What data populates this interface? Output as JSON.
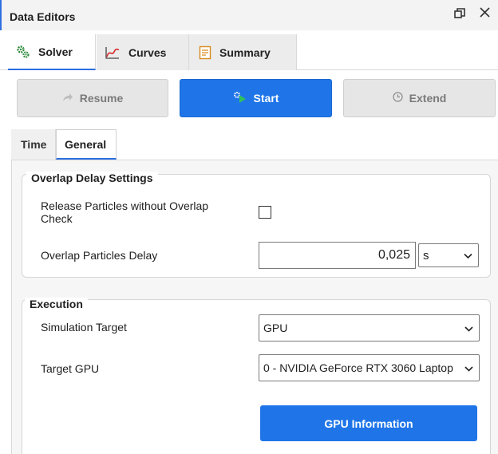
{
  "panel": {
    "title": "Data Editors",
    "restore_icon": "restore-window-icon",
    "close_icon": "close-icon"
  },
  "tabs": [
    {
      "label": "Solver",
      "icon": "gears-icon",
      "active": true
    },
    {
      "label": "Curves",
      "icon": "line-chart-icon",
      "active": false
    },
    {
      "label": "Summary",
      "icon": "document-icon",
      "active": false
    }
  ],
  "actions": {
    "resume_label": "Resume",
    "start_label": "Start",
    "extend_label": "Extend"
  },
  "subtabs": [
    {
      "label": "Time",
      "active": false
    },
    {
      "label": "General",
      "active": true
    }
  ],
  "overlap": {
    "title": "Overlap Delay Settings",
    "release_label": "Release Particles without Overlap Check",
    "release_checked": false,
    "delay_label": "Overlap Particles Delay",
    "delay_value": "0,025",
    "delay_unit": "s"
  },
  "execution": {
    "title": "Execution",
    "sim_target_label": "Simulation Target",
    "sim_target_value": "GPU",
    "target_gpu_label": "Target GPU",
    "target_gpu_value": "0 - NVIDIA GeForce RTX 3060 Laptop",
    "gpu_info_label": "GPU Information"
  },
  "colors": {
    "accent": "#1f75e8",
    "header_bg": "#f3f3f3"
  }
}
